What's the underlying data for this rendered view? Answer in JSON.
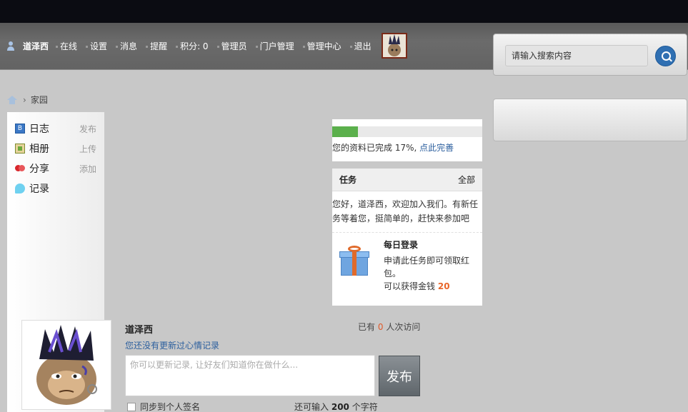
{
  "nav": {
    "username": "道泽西",
    "items": [
      "在线",
      "设置",
      "消息",
      "提醒",
      "积分: 0",
      "管理员",
      "门户管理",
      "管理中心",
      "退出"
    ]
  },
  "search": {
    "placeholder": "请输入搜索内容"
  },
  "breadcrumb": {
    "current": "家园",
    "separator": "›"
  },
  "sidebar": {
    "items": [
      {
        "label": "日志",
        "action": "发布",
        "icon": "blog-icon"
      },
      {
        "label": "相册",
        "action": "上传",
        "icon": "album-icon"
      },
      {
        "label": "分享",
        "action": "添加",
        "icon": "share-icon"
      },
      {
        "label": "记录",
        "action": "",
        "icon": "record-icon"
      }
    ]
  },
  "profile_progress": {
    "percent": 17,
    "text": "您的资料已完成 17%,",
    "link": "点此完善"
  },
  "tasks": {
    "title": "任务",
    "all_link": "全部",
    "intro": "您好，道泽西，欢迎加入我们。有新任务等着您，挺简单的，赶快来参加吧",
    "item": {
      "title": "每日登录",
      "desc": "申请此任务即可领取红包。",
      "reward_prefix": "可以获得金钱",
      "reward_value": "20"
    }
  },
  "profile": {
    "name": "道泽西",
    "visits_prefix": "已有",
    "visits_count": "0",
    "visits_suffix": "人次访问",
    "mood_link": "您还没有更新过心情记录",
    "mood_placeholder": "你可以更新记录, 让好友们知道你在做什么...",
    "publish_label": "发布",
    "sync_label": "同步到个人签名",
    "remaining_prefix": "还可输入",
    "remaining_count": "200",
    "remaining_suffix": "个字符"
  },
  "colors": {
    "accent_blue": "#2f6fb2",
    "progress_green": "#5bb04c",
    "highlight_orange": "#e8662a"
  }
}
